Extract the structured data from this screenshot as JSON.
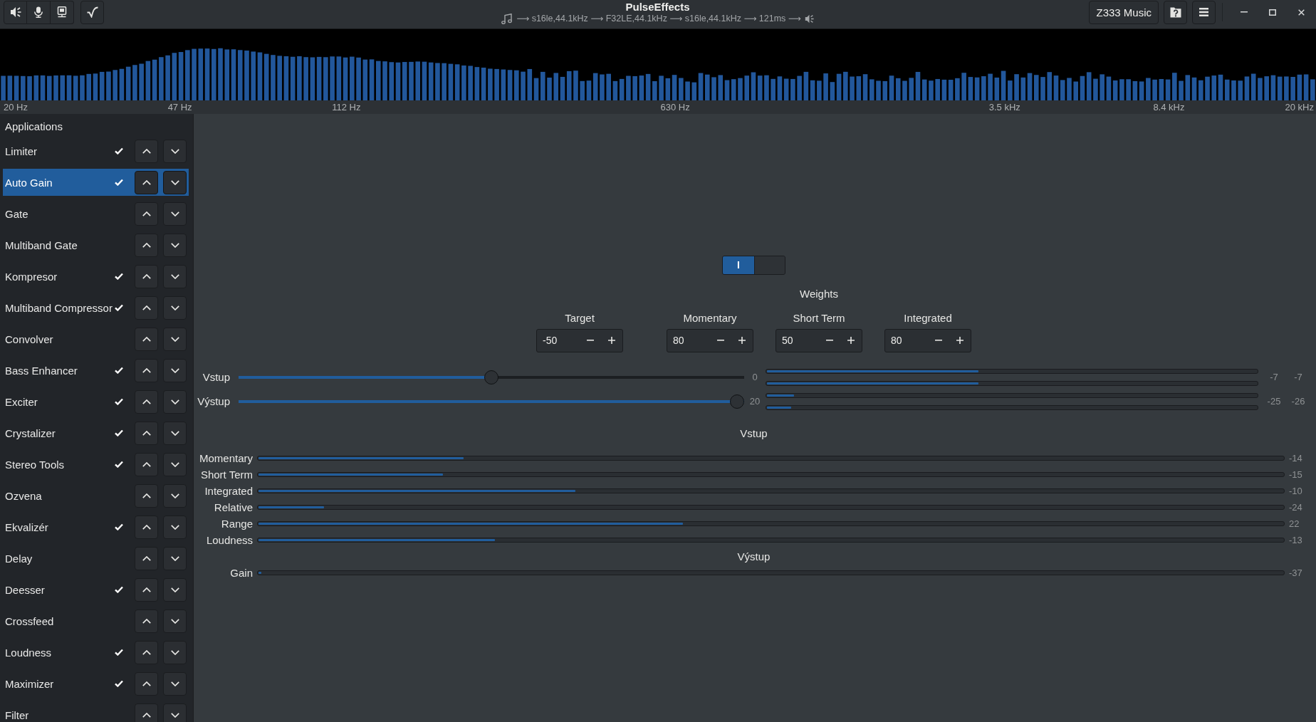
{
  "header": {
    "title": "PulseEffects",
    "pipeline": "⟶ s16le,44.1kHz ⟶ F32LE,44.1kHz ⟶ s16le,44.1kHz ⟶ 121ms ⟶",
    "preset_button": "Z333 Music"
  },
  "spectrum": {
    "axis_labels": [
      "20 Hz",
      "47 Hz",
      "112 Hz",
      "630 Hz",
      "3.5 kHz",
      "8.4 kHz",
      "20 kHz"
    ]
  },
  "sidebar": {
    "items": [
      {
        "kind": "page",
        "label": "Applications",
        "checked": false,
        "selected": false
      },
      {
        "kind": "plugin",
        "label": "Limiter",
        "checked": true,
        "selected": false
      },
      {
        "kind": "plugin",
        "label": "Auto Gain",
        "checked": true,
        "selected": true
      },
      {
        "kind": "plugin",
        "label": "Gate",
        "checked": false,
        "selected": false
      },
      {
        "kind": "plugin",
        "label": "Multiband Gate",
        "checked": false,
        "selected": false
      },
      {
        "kind": "plugin",
        "label": "Kompresor",
        "checked": true,
        "selected": false
      },
      {
        "kind": "plugin",
        "label": "Multiband Compressor",
        "checked": true,
        "selected": false
      },
      {
        "kind": "plugin",
        "label": "Convolver",
        "checked": false,
        "selected": false
      },
      {
        "kind": "plugin",
        "label": "Bass Enhancer",
        "checked": true,
        "selected": false
      },
      {
        "kind": "plugin",
        "label": "Exciter",
        "checked": true,
        "selected": false
      },
      {
        "kind": "plugin",
        "label": "Crystalizer",
        "checked": true,
        "selected": false
      },
      {
        "kind": "plugin",
        "label": "Stereo Tools",
        "checked": true,
        "selected": false
      },
      {
        "kind": "plugin",
        "label": "Ozvena",
        "checked": false,
        "selected": false
      },
      {
        "kind": "plugin",
        "label": "Ekvalizér",
        "checked": true,
        "selected": false
      },
      {
        "kind": "plugin",
        "label": "Delay",
        "checked": false,
        "selected": false
      },
      {
        "kind": "plugin",
        "label": "Deesser",
        "checked": true,
        "selected": false
      },
      {
        "kind": "plugin",
        "label": "Crossfeed",
        "checked": false,
        "selected": false
      },
      {
        "kind": "plugin",
        "label": "Loudness",
        "checked": true,
        "selected": false
      },
      {
        "kind": "plugin",
        "label": "Maximizer",
        "checked": true,
        "selected": false
      },
      {
        "kind": "plugin",
        "label": "Filter",
        "checked": false,
        "selected": false
      }
    ]
  },
  "auto_gain": {
    "switch": {
      "on": true,
      "label": "I"
    },
    "weights_title": "Weights",
    "target": {
      "label": "Target",
      "value": "-50"
    },
    "weights": [
      {
        "label": "Momentary",
        "value": "80"
      },
      {
        "label": "Short Term",
        "value": "50"
      },
      {
        "label": "Integrated",
        "value": "80"
      }
    ],
    "gain_sliders": [
      {
        "label": "Vstup",
        "level": 0.5,
        "reading": "0",
        "meters": [
          {
            "level": 0.432,
            "reading": "-7"
          },
          {
            "level": 0.432,
            "reading": "-7"
          }
        ]
      },
      {
        "label": "Výstup",
        "level": 1,
        "reading": "20",
        "meters": [
          {
            "level": 0.055,
            "reading": "-25"
          },
          {
            "level": 0.05,
            "reading": "-26"
          }
        ]
      }
    ],
    "input_title": "Vstup",
    "input_meters": [
      {
        "label": "Momentary",
        "level": 0.2,
        "reading": "-14"
      },
      {
        "label": "Short Term",
        "level": 0.18,
        "reading": "-15"
      },
      {
        "label": "Integrated",
        "level": 0.309,
        "reading": "-10"
      },
      {
        "label": "Relative",
        "level": 0.064,
        "reading": "-24"
      },
      {
        "label": "Range",
        "level": 0.414,
        "reading": "22"
      },
      {
        "label": "Loudness",
        "level": 0.231,
        "reading": "-13"
      }
    ],
    "output_title": "Výstup",
    "output_meters": [
      {
        "label": "Gain",
        "level": 0.003,
        "reading": "-37"
      }
    ]
  }
}
